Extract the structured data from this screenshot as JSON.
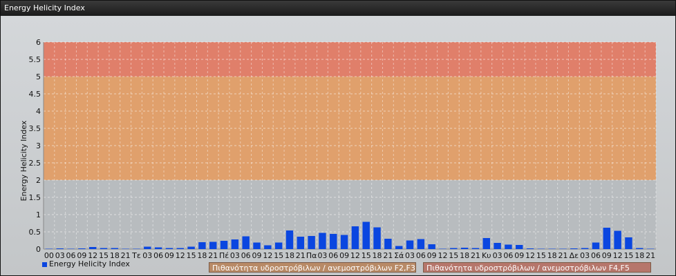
{
  "window": {
    "title": "Energy Helicity Index"
  },
  "chart_data": {
    "type": "bar",
    "title": "",
    "ylabel": "Energy Helicity Index",
    "xlabel": "",
    "ylim": [
      0,
      6
    ],
    "yticks": [
      "0",
      "0.5",
      "1",
      "1.5",
      "2",
      "2.5",
      "3",
      "3.5",
      "4",
      "4.5",
      "5",
      "5.5",
      "6"
    ],
    "categories": [
      "00",
      "03",
      "06",
      "09",
      "12",
      "15",
      "18",
      "21",
      "Τε",
      "03",
      "06",
      "09",
      "12",
      "15",
      "18",
      "21",
      "Πέ",
      "03",
      "06",
      "09",
      "12",
      "15",
      "18",
      "21",
      "Πα",
      "03",
      "06",
      "09",
      "12",
      "15",
      "18",
      "21",
      "Σά",
      "03",
      "06",
      "09",
      "12",
      "15",
      "18",
      "21",
      "Κυ",
      "03",
      "06",
      "09",
      "12",
      "15",
      "18",
      "21",
      "Δε",
      "03",
      "06",
      "09",
      "12",
      "15",
      "18",
      "21"
    ],
    "series": [
      {
        "name": "Energy Helicity Index",
        "color": "#0a46e0",
        "values": [
          0.01,
          0.02,
          0.01,
          0.02,
          0.06,
          0.03,
          0.03,
          0.01,
          0.01,
          0.07,
          0.05,
          0.03,
          0.03,
          0.07,
          0.2,
          0.21,
          0.24,
          0.28,
          0.37,
          0.19,
          0.11,
          0.19,
          0.54,
          0.36,
          0.38,
          0.47,
          0.44,
          0.41,
          0.66,
          0.79,
          0.63,
          0.3,
          0.09,
          0.25,
          0.29,
          0.14,
          0.01,
          0.03,
          0.04,
          0.03,
          0.32,
          0.18,
          0.13,
          0.12,
          0.02,
          0.01,
          0.01,
          0.01,
          0.02,
          0.03,
          0.19,
          0.62,
          0.53,
          0.34,
          0.03,
          0.01
        ]
      }
    ],
    "bands": [
      {
        "from": 0,
        "to": 2,
        "color": "#b8bcbf"
      },
      {
        "from": 2,
        "to": 5,
        "color": "#e0a06c"
      },
      {
        "from": 5,
        "to": 6,
        "color": "#e07f6a"
      }
    ],
    "legend": {
      "placement": "bottom-left",
      "items": [
        {
          "label": "Energy Helicity Index",
          "color": "#0a46e0"
        },
        {
          "label": "Πιθανότητα υδροστρόβιλων / ανεμοστρόβιλων F2,F3",
          "color": "#d89a6a"
        },
        {
          "label": "Πιθανότητα υδροστρόβιλων / ανεμοστρόβιλων F4,F5",
          "color": "#c97062"
        }
      ]
    },
    "grid": true
  }
}
